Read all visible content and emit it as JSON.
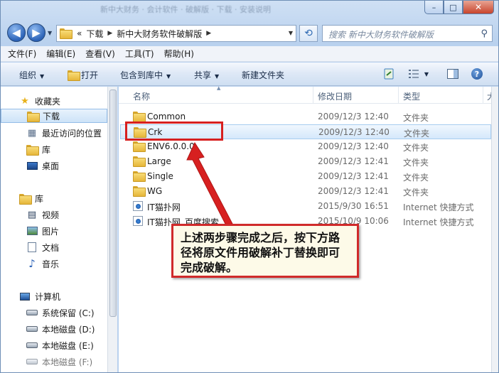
{
  "window": {
    "title": "新中大财务 · 会计软件 · 破解版 · 下载 · 安装说明",
    "caption": {
      "minimize": "–",
      "maximize": "□",
      "close": "✕"
    }
  },
  "address": {
    "overflow": "«",
    "segments": [
      "下载",
      "新中大财务软件破解版"
    ],
    "search_placeholder": "搜索 新中大财务软件破解版"
  },
  "menu": [
    "文件(F)",
    "编辑(E)",
    "查看(V)",
    "工具(T)",
    "帮助(H)"
  ],
  "toolbar": {
    "organize": "组织",
    "open": "打开",
    "include": "包含到库中",
    "share": "共享",
    "new_folder": "新建文件夹"
  },
  "nav": {
    "favorites": "收藏夹",
    "downloads": "下载",
    "recent": "最近访问的位置",
    "library_fav": "库",
    "desktop": "桌面",
    "libraries": "库",
    "videos": "视频",
    "pictures": "图片",
    "documents": "文档",
    "music": "音乐",
    "computer": "计算机",
    "drive_c": "系统保留 (C:)",
    "drive_d": "本地磁盘 (D:)",
    "drive_e": "本地磁盘 (E:)",
    "drive_f": "本地磁盘 (F:)"
  },
  "columns": {
    "name": "名称",
    "date": "修改日期",
    "type": "类型",
    "size": "大"
  },
  "files": [
    {
      "name": "Common",
      "date": "2009/12/3 12:40",
      "type": "文件夹",
      "icon": "folder-icon"
    },
    {
      "name": "Crk",
      "date": "2009/12/3 12:40",
      "type": "文件夹",
      "icon": "folder-icon"
    },
    {
      "name": "ENV6.0.0.0",
      "date": "2009/12/3 12:40",
      "type": "文件夹",
      "icon": "folder-icon"
    },
    {
      "name": "Large",
      "date": "2009/12/3 12:41",
      "type": "文件夹",
      "icon": "folder-icon"
    },
    {
      "name": "Single",
      "date": "2009/12/3 12:41",
      "type": "文件夹",
      "icon": "folder-icon"
    },
    {
      "name": "WG",
      "date": "2009/12/3 12:41",
      "type": "文件夹",
      "icon": "folder-icon"
    },
    {
      "name": "IT猫扑网",
      "date": "2015/9/30 16:51",
      "type": "Internet 快捷方式",
      "icon": "internet-shortcut-icon"
    },
    {
      "name": "IT猫扑网_百度搜索",
      "date": "2015/10/9 10:06",
      "type": "Internet 快捷方式",
      "icon": "internet-shortcut-icon"
    }
  ],
  "annotation": {
    "text": "上述两步骤完成之后，按下方路径将原文件用破解补丁替换即可完成破解。",
    "color": "#d72020"
  }
}
